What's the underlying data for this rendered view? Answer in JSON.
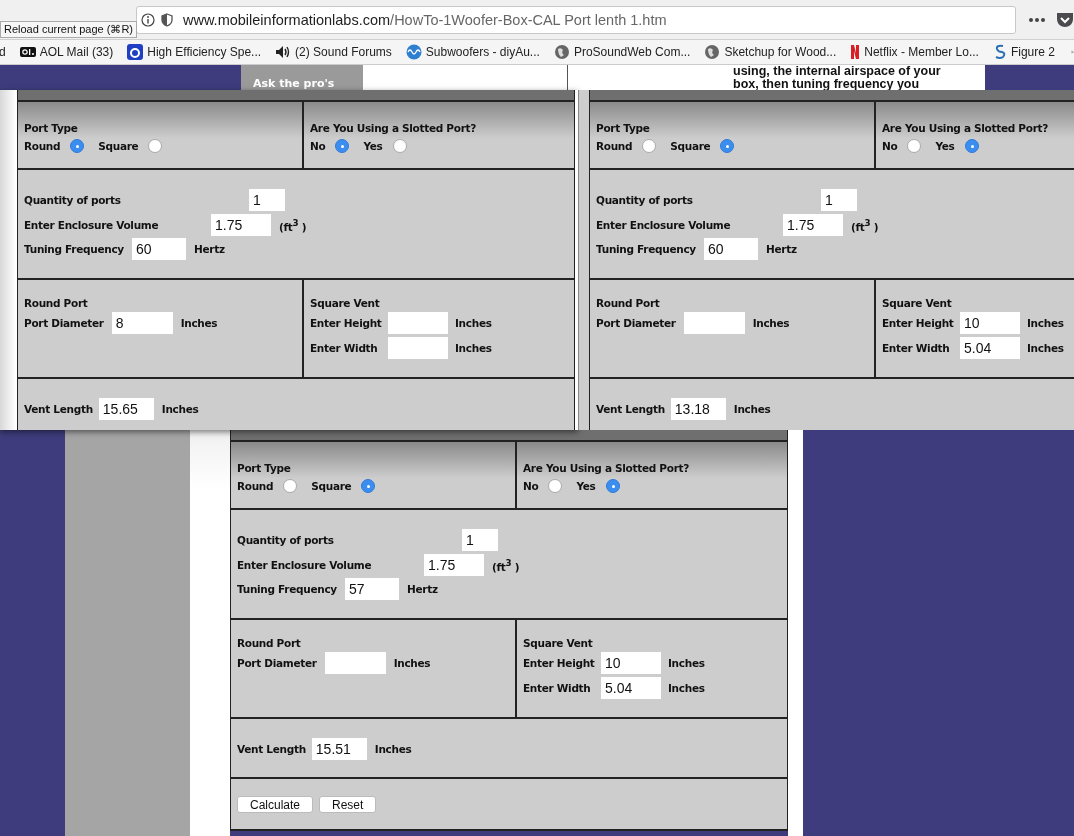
{
  "browser": {
    "tooltip": "Reload current page (⌘R)",
    "url_host": "www.mobileinformationlabs.com",
    "url_path": "/HowTo-1Woofer-Box-CAL Port lenth 1.htm",
    "bookmarks": [
      {
        "label": "d",
        "kind": "none"
      },
      {
        "label": "AOL Mail (33)",
        "kind": "aol"
      },
      {
        "label": "High Efficiency Spe...",
        "kind": "letter"
      },
      {
        "label": "(2) Sound Forums",
        "kind": "speaker"
      },
      {
        "label": "Subwoofers - diyAu...",
        "kind": "wave"
      },
      {
        "label": "ProSoundWeb Com...",
        "kind": "globe"
      },
      {
        "label": "Sketchup for Wood...",
        "kind": "globe"
      },
      {
        "label": "Netflix - Member Lo...",
        "kind": "netflix"
      },
      {
        "label": "Figure 2",
        "kind": "curl"
      }
    ]
  },
  "page": {
    "ask_label": "Ask the pro's",
    "intro_lines": [
      "using, the internal airspace of your",
      "box, then tuning frequency you"
    ]
  },
  "forms": [
    {
      "port_type": {
        "label": "Port Type",
        "options": [
          {
            "label": "Round",
            "selected": true
          },
          {
            "label": "Square",
            "selected": false
          }
        ]
      },
      "slotted": {
        "label": "Are You Using a Slotted Port?",
        "options": [
          {
            "label": "No",
            "selected": true
          },
          {
            "label": "Yes",
            "selected": false
          }
        ]
      },
      "fields": [
        {
          "label": "Quantity of ports",
          "value": "1"
        },
        {
          "label": "Enter Enclosure Volume",
          "value": "1.75",
          "unit": "(ft$^{3}$ )"
        },
        {
          "label": "Tuning Frequency",
          "value": "60",
          "unit": "Hertz"
        }
      ],
      "round_port": {
        "title": "Round Port",
        "fields": [
          {
            "label": "Port Diameter",
            "value": "8",
            "unit": "Inches"
          }
        ]
      },
      "square_vent": {
        "title": "Square Vent",
        "fields": [
          {
            "label": "Enter Height",
            "unit": "Inches"
          },
          {
            "label": "Enter Width",
            "unit": "Inches"
          }
        ]
      },
      "vent_length": {
        "label": "Vent Length",
        "value": "15.65",
        "unit": "Inches"
      }
    },
    {
      "port_type": {
        "label": "Port Type",
        "options": [
          {
            "label": "Round",
            "selected": false
          },
          {
            "label": "Square",
            "selected": true
          }
        ]
      },
      "slotted": {
        "label": "Are You Using a Slotted Port?",
        "options": [
          {
            "label": "No",
            "selected": false
          },
          {
            "label": "Yes",
            "selected": true
          }
        ]
      },
      "fields": [
        {
          "label": "Quantity of ports",
          "value": "1"
        },
        {
          "label": "Enter Enclosure Volume",
          "value": "1.75",
          "unit": "(ft$^{3}$ )"
        },
        {
          "label": "Tuning Frequency",
          "value": "60",
          "unit": "Hertz"
        }
      ],
      "round_port": {
        "title": "Round Port",
        "fields": [
          {
            "label": "Port Diameter",
            "unit": "Inches"
          }
        ]
      },
      "square_vent": {
        "title": "Square Vent",
        "fields": [
          {
            "label": "Enter Height",
            "value": "10",
            "unit": "Inches"
          },
          {
            "label": "Enter Width",
            "value": "5.04",
            "unit": "Inches"
          }
        ]
      },
      "vent_length": {
        "label": "Vent Length",
        "value": "13.18",
        "unit": "Inches"
      }
    },
    {
      "port_type": {
        "label": "Port Type",
        "options": [
          {
            "label": "Round",
            "selected": false
          },
          {
            "label": "Square",
            "selected": true
          }
        ]
      },
      "slotted": {
        "label": "Are You Using a Slotted Port?",
        "options": [
          {
            "label": "No",
            "selected": false
          },
          {
            "label": "Yes",
            "selected": true
          }
        ]
      },
      "fields": [
        {
          "label": "Quantity of ports",
          "value": "1"
        },
        {
          "label": "Enter Enclosure Volume",
          "value": "1.75",
          "unit": "(ft$^{3}$ )"
        },
        {
          "label": "Tuning Frequency",
          "value": "57",
          "unit": "Hertz"
        }
      ],
      "round_port": {
        "title": "Round Port",
        "fields": [
          {
            "label": "Port Diameter",
            "unit": "Inches"
          }
        ]
      },
      "square_vent": {
        "title": "Square Vent",
        "fields": [
          {
            "label": "Enter Height",
            "value": "10",
            "unit": "Inches"
          },
          {
            "label": "Enter Width",
            "value": "5.04",
            "unit": "Inches"
          }
        ]
      },
      "vent_length": {
        "label": "Vent Length",
        "value": "15.51",
        "unit": "Inches"
      },
      "buttons": [
        "Calculate",
        "Reset"
      ]
    }
  ]
}
